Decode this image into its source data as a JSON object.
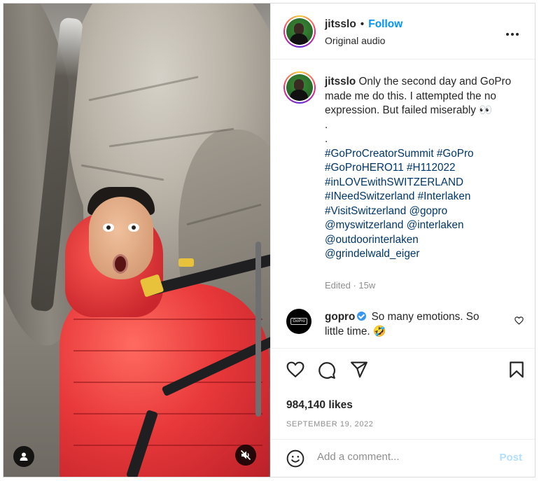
{
  "post": {
    "username": "jitsslo",
    "separator": "•",
    "follow_label": "Follow",
    "audio": "Original audio",
    "more_label": "•••"
  },
  "caption": {
    "username": "jitsslo",
    "text": "Only the second day and GoPro made me do this. I attempted the no expression. But failed miserably 👀",
    "dot1": ".",
    "dot2": ".",
    "tags": [
      "#GoProCreatorSummit",
      "#GoPro",
      "#GoProHERO11",
      "#H112022",
      "#inLOVEwithSWITZERLAND",
      "#INeedSwitzerland",
      "#Interlaken",
      "#VisitSwitzerland",
      "@gopro",
      "@myswitzerland",
      "@interlaken",
      "@outdoorinterlaken",
      "@grindelwald_eiger"
    ],
    "meta": "Edited · 15w"
  },
  "comment": {
    "username": "gopro",
    "text": "So many emotions. So little time. 🤣",
    "avatar_label": "GoPro"
  },
  "actions": {
    "likes": "984,140 likes",
    "date": "SEPTEMBER 19, 2022"
  },
  "composer": {
    "placeholder": "Add a comment...",
    "post_label": "Post"
  },
  "colors": {
    "link": "#0095f6",
    "hashtag": "#00376b",
    "muted": "#8e8e8e",
    "post_disabled": "#b2dffc"
  },
  "icons": {
    "like": "heart-icon",
    "comment": "comment-icon",
    "share": "send-icon",
    "save": "bookmark-icon",
    "emoji": "smiley-icon",
    "user_tag": "user-icon",
    "mute": "speaker-muted-icon",
    "more": "more-horizontal-icon"
  }
}
